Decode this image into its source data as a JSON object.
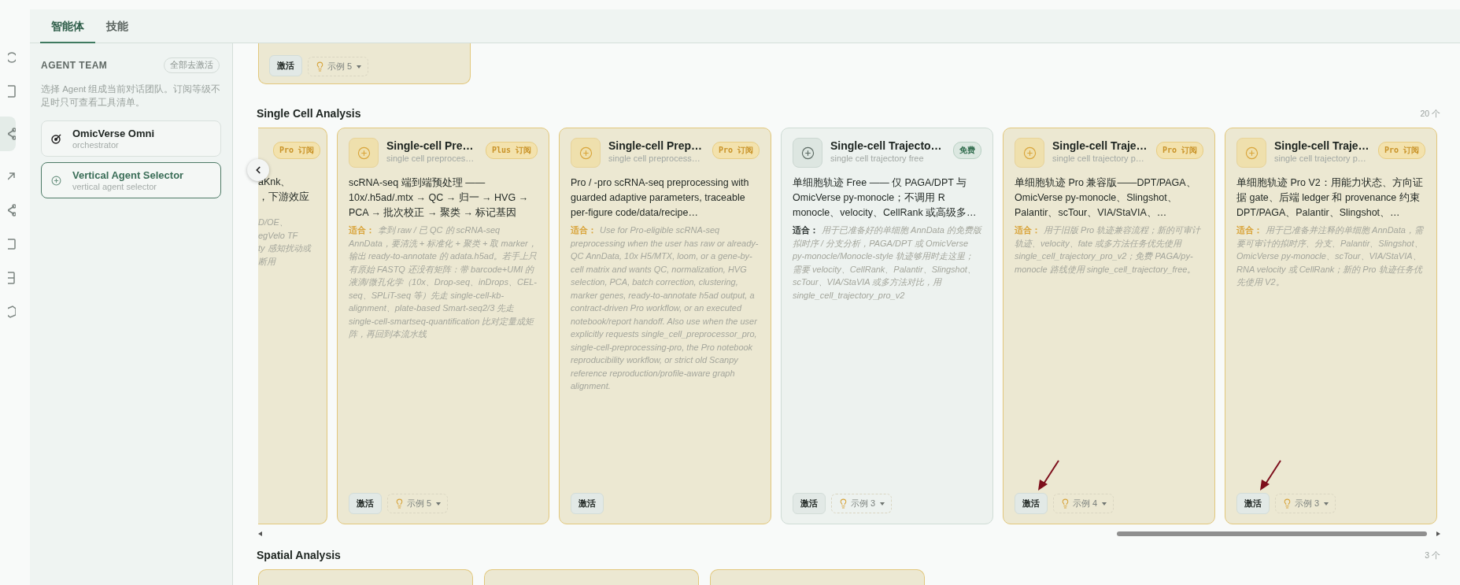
{
  "rail": [
    {
      "selected": false
    },
    {
      "selected": false
    },
    {
      "selected": true
    },
    {
      "selected": false
    },
    {
      "selected": false
    },
    {
      "selected": false
    },
    {
      "selected": false
    },
    {
      "selected": false
    }
  ],
  "tabs": [
    {
      "label": "智能体",
      "selected": true
    },
    {
      "label": "技能",
      "selected": false
    }
  ],
  "sidebar": {
    "title": "AGENT TEAM",
    "deactivate_all": "全部去激活",
    "hint": "选择 Agent 组成当前对话团队。订阅等级不足时只可查看工具清单。",
    "agents": [
      {
        "name": "OmicVerse Omni",
        "role": "orchestrator",
        "selected": false
      },
      {
        "name": "Vertical Agent Selector",
        "role": "vertical agent selector",
        "selected": true
      }
    ]
  },
  "top_card": {
    "activate": "激活",
    "examples": "示例 5"
  },
  "sections": [
    {
      "title": "Single Cell Analysis",
      "count": "20 个",
      "partial_card": {
        "badge": "Pro 订阅",
        "description": [
          "aKnk、",
          "，下游效应"
        ],
        "fit": [
          "D/OE、",
          "egVelo TF",
          "ty 感知扰动或",
          "断用"
        ]
      },
      "cards": [
        {
          "kind": "plus",
          "title": "Single-cell Pre…",
          "subtitle": "single cell preproces…",
          "badge": "Plus 订阅",
          "description": "scRNA-seq 端到端预处理 —— 10x/.h5ad/.mtx → QC → 归一 → HVG → PCA → 批次校正 → 聚类 → 标记基因",
          "fit_label": "适合：",
          "fit": "拿到 raw / 已 QC 的 scRNA-seq AnnData，要清洗 + 标准化 + 聚类 + 取 marker，输出 ready-to-annotate 的 adata.h5ad。若手上只有原始 FASTQ 还没有矩阵：带 barcode+UMI 的液滴/微孔化学（10x、Drop-seq、inDrops、CEL-seq、SPLiT-seq 等）先走 single-cell-kb-alignment、plate-based Smart-seq2/3 先走 single-cell-smartseq-quantification 比对定量成矩阵，再回到本流水线",
          "activate": "激活",
          "examples": "示例 5",
          "annotated": false
        },
        {
          "kind": "pro",
          "title": "Single-cell Prep…",
          "subtitle": "single cell preprocess…",
          "badge": "Pro 订阅",
          "description": "Pro / -pro scRNA-seq preprocessing with guarded adaptive parameters, traceable per-figure code/data/recipe…",
          "fit_label": "适合：",
          "fit": "Use for Pro-eligible scRNA-seq preprocessing when the user has raw or already-QC AnnData, 10x H5/MTX, loom, or a gene-by-cell matrix and wants QC, normalization, HVG selection, PCA, batch correction, clustering, marker genes, ready-to-annotate h5ad output, a contract-driven Pro workflow, or an executed notebook/report handoff. Also use when the user explicitly requests single_cell_preprocessor_pro, single-cell-preprocessing-pro, the Pro notebook reproducibility workflow, or strict old Scanpy reference reproduction/profile-aware graph alignment.",
          "activate": "激活",
          "annotated": false
        },
        {
          "kind": "free",
          "title": "Single-cell Trajecto…",
          "subtitle": "single cell trajectory free",
          "badge": "免费",
          "description": "单细胞轨迹 Free —— 仅 PAGA/DPT 与 OmicVerse py-monocle；不调用 R monocle、velocity、CellRank 或高级多…",
          "fit_label": "适合：",
          "fit": "用于已准备好的单细胞 AnnData 的免费版拟时序 / 分支分析，PAGA/DPT 或 OmicVerse py-monocle/Monocle-style 轨迹够用时走这里；需要 velocity、CellRank、Palantir、Slingshot、scTour、VIA/StaVIA 或多方法对比，用 single_cell_trajectory_pro_v2",
          "activate": "激活",
          "examples": "示例 3",
          "annotated": false
        },
        {
          "kind": "pro",
          "title": "Single-cell Traje…",
          "subtitle": "single cell trajectory p…",
          "badge": "Pro 订阅",
          "description": "单细胞轨迹 Pro 兼容版——DPT/PAGA、OmicVerse py-monocle、Slingshot、Palantir、scTour、VIA/StaVIA、…",
          "fit_label": "适合：",
          "fit": "用于旧版 Pro 轨迹兼容流程；新的可审计轨迹、velocity、fate 或多方法任务优先使用 single_cell_trajectory_pro_v2；免费 PAGA/py-monocle 路线使用 single_cell_trajectory_free。",
          "activate": "激活",
          "examples": "示例 4",
          "annotated": true
        },
        {
          "kind": "pro",
          "title": "Single-cell Traje…",
          "subtitle": "single cell trajectory p…",
          "badge": "Pro 订阅",
          "description": "单细胞轨迹 Pro V2：用能力状态、方向证据 gate、后端 ledger 和 provenance 约束 DPT/PAGA、Palantir、Slingshot、…",
          "fit_label": "适合：",
          "fit": "用于已准备并注释的单细胞 AnnData，需要可审计的拟时序、分支、Palantir、Slingshot、OmicVerse py-monocle、scTour、VIA/StaVIA、RNA velocity 或 CellRank；新的 Pro 轨迹任务优先使用 V2。",
          "activate": "激活",
          "examples": "示例 3",
          "annotated": true
        }
      ]
    },
    {
      "title": "Spatial Analysis",
      "count": "3 个",
      "peek_cards": [
        {
          "kind": "pro"
        },
        {
          "kind": "pro"
        },
        {
          "kind": "pro"
        }
      ]
    }
  ]
}
